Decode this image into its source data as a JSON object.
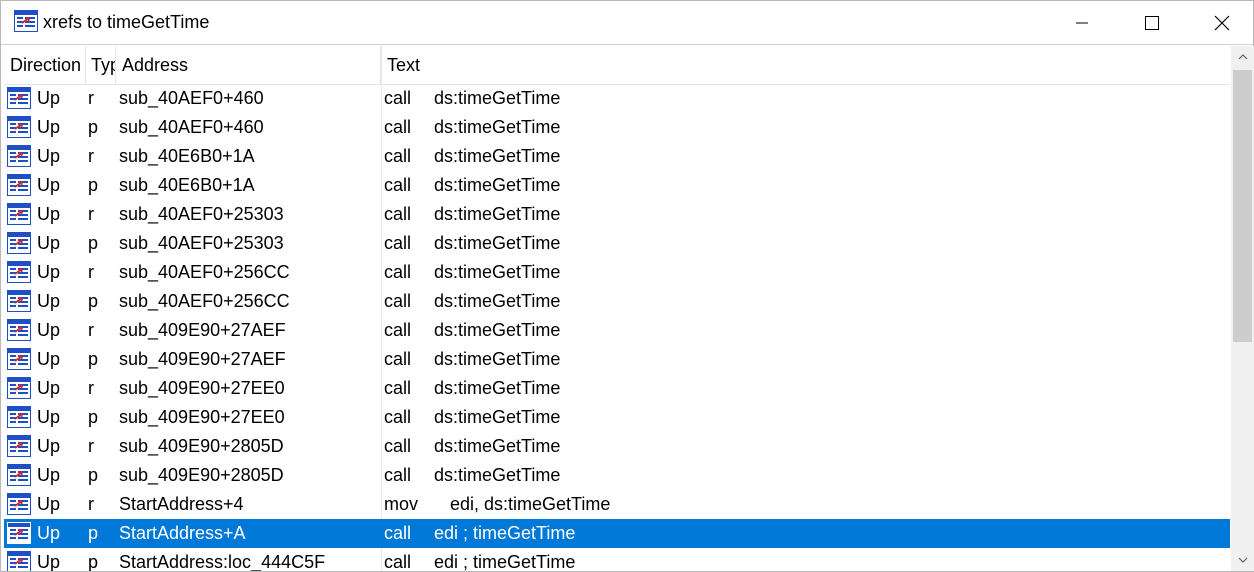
{
  "window": {
    "title": "xrefs to timeGetTime"
  },
  "columns": {
    "direction": "Direction",
    "type": "Type",
    "address": "Address",
    "text": "Text"
  },
  "rows": [
    {
      "direction": "Up",
      "type": "r",
      "address": "sub_40AEF0+460",
      "mnemonic": "call",
      "operand": "ds:timeGetTime"
    },
    {
      "direction": "Up",
      "type": "p",
      "address": "sub_40AEF0+460",
      "mnemonic": "call",
      "operand": "ds:timeGetTime"
    },
    {
      "direction": "Up",
      "type": "r",
      "address": "sub_40E6B0+1A",
      "mnemonic": "call",
      "operand": "ds:timeGetTime"
    },
    {
      "direction": "Up",
      "type": "p",
      "address": "sub_40E6B0+1A",
      "mnemonic": "call",
      "operand": "ds:timeGetTime"
    },
    {
      "direction": "Up",
      "type": "r",
      "address": "sub_40AEF0+25303",
      "mnemonic": "call",
      "operand": "ds:timeGetTime"
    },
    {
      "direction": "Up",
      "type": "p",
      "address": "sub_40AEF0+25303",
      "mnemonic": "call",
      "operand": "ds:timeGetTime"
    },
    {
      "direction": "Up",
      "type": "r",
      "address": "sub_40AEF0+256CC",
      "mnemonic": "call",
      "operand": "ds:timeGetTime"
    },
    {
      "direction": "Up",
      "type": "p",
      "address": "sub_40AEF0+256CC",
      "mnemonic": "call",
      "operand": "ds:timeGetTime"
    },
    {
      "direction": "Up",
      "type": "r",
      "address": "sub_409E90+27AEF",
      "mnemonic": "call",
      "operand": "ds:timeGetTime"
    },
    {
      "direction": "Up",
      "type": "p",
      "address": "sub_409E90+27AEF",
      "mnemonic": "call",
      "operand": "ds:timeGetTime"
    },
    {
      "direction": "Up",
      "type": "r",
      "address": "sub_409E90+27EE0",
      "mnemonic": "call",
      "operand": "ds:timeGetTime"
    },
    {
      "direction": "Up",
      "type": "p",
      "address": "sub_409E90+27EE0",
      "mnemonic": "call",
      "operand": "ds:timeGetTime"
    },
    {
      "direction": "Up",
      "type": "r",
      "address": "sub_409E90+2805D",
      "mnemonic": "call",
      "operand": "ds:timeGetTime"
    },
    {
      "direction": "Up",
      "type": "p",
      "address": "sub_409E90+2805D",
      "mnemonic": "call",
      "operand": "ds:timeGetTime"
    },
    {
      "direction": "Up",
      "type": "r",
      "address": "StartAddress+4",
      "mnemonic": "mov",
      "operand": "edi, ds:timeGetTime"
    },
    {
      "direction": "Up",
      "type": "p",
      "address": "StartAddress+A",
      "mnemonic": "call",
      "operand": "edi ; timeGetTime",
      "selected": true
    },
    {
      "direction": "Up",
      "type": "p",
      "address": "StartAddress:loc_444C5F",
      "mnemonic": "call",
      "operand": "edi ; timeGetTime"
    }
  ],
  "icons": {
    "title": "xref-list-icon",
    "row": "xref-list-icon"
  },
  "colors": {
    "selection": "#0078d7",
    "icon_blue": "#1f4fc7",
    "icon_red": "#d2262a"
  }
}
